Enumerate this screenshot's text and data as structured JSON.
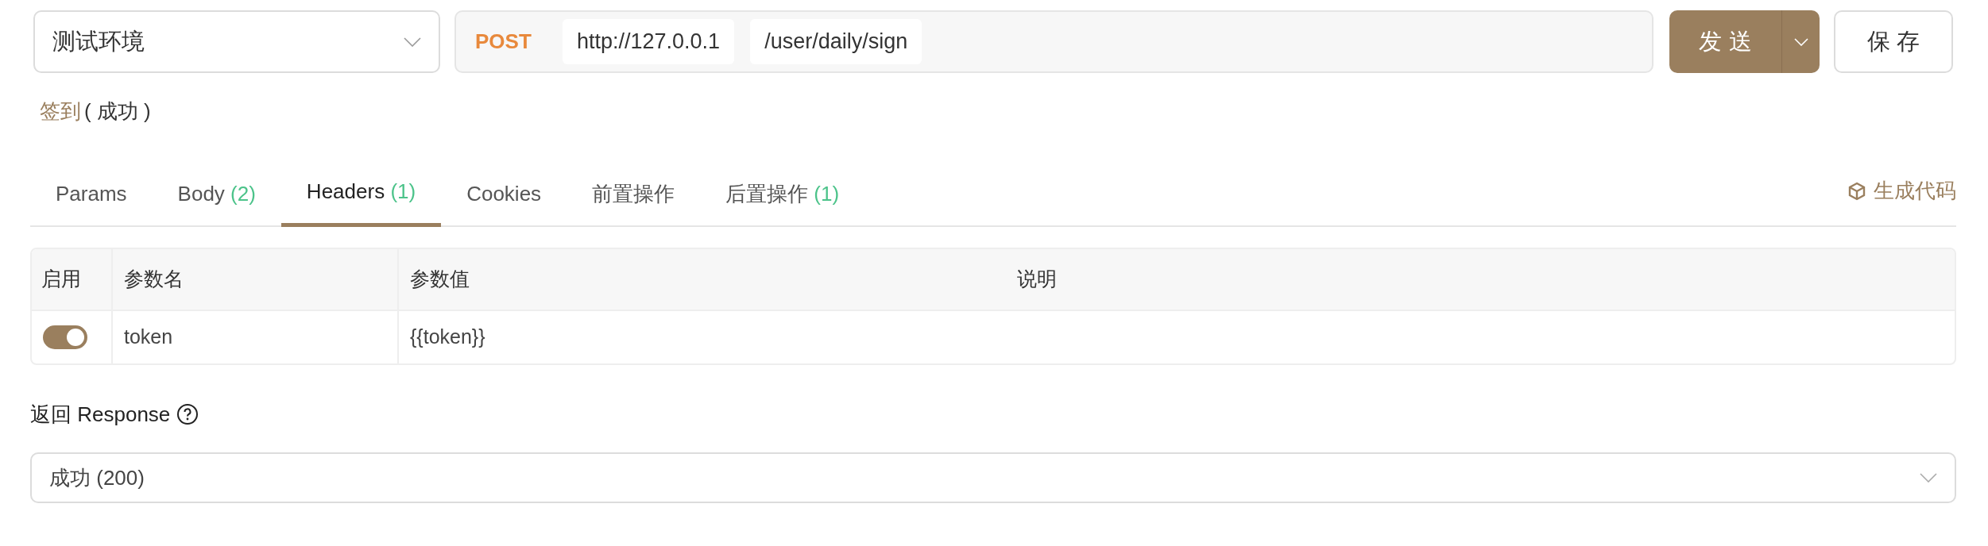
{
  "environment": {
    "value": "测试环境"
  },
  "request": {
    "method": "POST",
    "base_url": "http://127.0.0.1",
    "path": "/user/daily/sign"
  },
  "buttons": {
    "send": "发 送",
    "save": "保 存"
  },
  "title": {
    "name": "签到",
    "status": "( 成功 )"
  },
  "tabs": [
    {
      "label": "Params",
      "selected": false
    },
    {
      "label": "Body",
      "count": "(2)",
      "selected": false
    },
    {
      "label": "Headers",
      "count": "(1)",
      "selected": true
    },
    {
      "label": "Cookies",
      "selected": false
    },
    {
      "label": "前置操作",
      "selected": false
    },
    {
      "label": "后置操作",
      "count": "(1)",
      "selected": false
    }
  ],
  "generate_code": "生成代码",
  "table": {
    "columns": [
      "启用",
      "参数名",
      "参数值",
      "说明"
    ],
    "rows": [
      {
        "enabled": true,
        "name": "token",
        "value": "{{token}}"
      }
    ]
  },
  "response": {
    "label": "返回 Response",
    "selected": "成功 (200)"
  }
}
